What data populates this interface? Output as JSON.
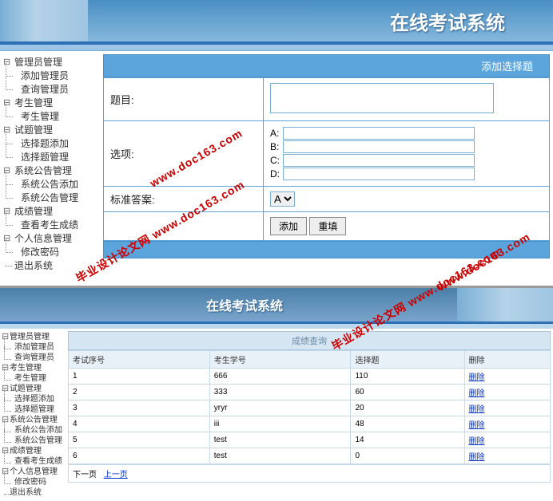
{
  "top": {
    "banner_title": "在线考试系统",
    "sidebar": [
      {
        "label": "管理员管理",
        "children": [
          "添加管理员",
          "查询管理员"
        ]
      },
      {
        "label": "考生管理",
        "children": [
          "考生管理"
        ]
      },
      {
        "label": "试题管理",
        "children": [
          "选择题添加",
          "选择题管理"
        ]
      },
      {
        "label": "系统公告管理",
        "children": [
          "系统公告添加",
          "系统公告管理"
        ]
      },
      {
        "label": "成绩管理",
        "children": [
          "查看考生成绩"
        ]
      },
      {
        "label": "个人信息管理",
        "children": [
          "修改密码"
        ]
      },
      {
        "label": "退出系统",
        "children": []
      }
    ],
    "panel_title": "添加选择题",
    "form": {
      "subject_label": "题目:",
      "option_label": "选项:",
      "opt_a": "A:",
      "opt_b": "B:",
      "opt_c": "C:",
      "opt_d": "D:",
      "answer_label": "标准答案:",
      "answer_value": "A",
      "btn_add": "添加",
      "btn_reset": "重填"
    }
  },
  "bottom": {
    "banner_title": "在线考试系统",
    "sidebar": [
      {
        "label": "管理员管理",
        "children": [
          "添加管理员",
          "查询管理员"
        ]
      },
      {
        "label": "考生管理",
        "children": [
          "考生管理"
        ]
      },
      {
        "label": "试题管理",
        "children": [
          "选择题添加",
          "选择题管理"
        ]
      },
      {
        "label": "系统公告管理",
        "children": [
          "系统公告添加",
          "系统公告管理"
        ]
      },
      {
        "label": "成绩管理",
        "children": [
          "查看考生成绩"
        ]
      },
      {
        "label": "个人信息管理",
        "children": [
          "修改密码"
        ]
      },
      {
        "label": "退出系统",
        "children": []
      }
    ],
    "sub_title": "成绩查询",
    "columns": [
      "考试序号",
      "考生学号",
      "选择题",
      "删除"
    ],
    "rows": [
      {
        "seq": "1",
        "sno": "666",
        "score": "110",
        "del": "删除"
      },
      {
        "seq": "2",
        "sno": "333",
        "score": "60",
        "del": "删除"
      },
      {
        "seq": "3",
        "sno": "yryr",
        "score": "20",
        "del": "删除"
      },
      {
        "seq": "4",
        "sno": "iii",
        "score": "48",
        "del": "删除"
      },
      {
        "seq": "5",
        "sno": "test",
        "score": "14",
        "del": "删除"
      },
      {
        "seq": "6",
        "sno": "test",
        "score": "0",
        "del": "删除"
      }
    ],
    "pager_next": "下一页",
    "pager_prev": "上一页"
  },
  "watermark": "毕业设计论文网 www.doc163.com"
}
